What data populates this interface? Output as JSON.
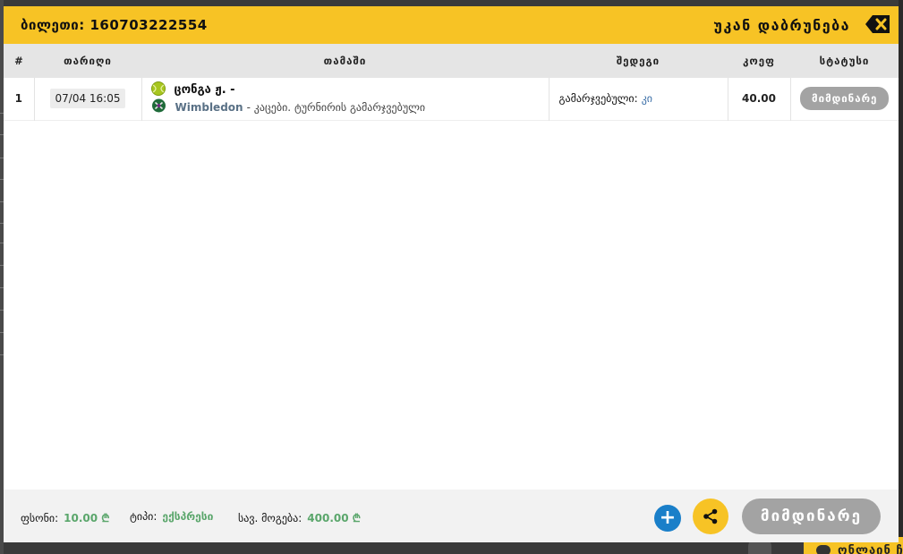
{
  "modal": {
    "ticket_label": "ბილეთი:",
    "ticket_number": "160703222554",
    "back_label": "უკან დაბრუნება"
  },
  "table": {
    "headers": [
      "#",
      "თარიღი",
      "თამაში",
      "შედეგი",
      "კოეფ",
      "სტატუსი"
    ],
    "rows": [
      {
        "num": "1",
        "date": "07/04 16:05",
        "player": "ცონგა ჟ. -",
        "tournament": "Wimbledon",
        "tournament_desc": "- კაცები. ტურნირის გამარჯვებული",
        "result_label": "გამარჯვებული:",
        "result_value": "კი",
        "odds": "40.00",
        "status": "მიმდინარე"
      }
    ]
  },
  "footer": {
    "stake_label": "ფსონი:",
    "stake_value": "10.00 ₾",
    "type_label": "ტიპი:",
    "type_value": "ექსპრესი",
    "win_label": "სავ. მოგება:",
    "win_value": "400.00 ₾",
    "status_button": "მიმდინარე"
  },
  "background": {
    "chat_label": "ონლაინ ჩ"
  },
  "icons": {
    "close": "backspace-x-icon",
    "sport": "tennis-ball-icon",
    "tournament": "wimbledon-logo-icon",
    "add": "plus-icon",
    "share": "share-icon",
    "chat": "chat-bubble-icon"
  },
  "colors": {
    "accent": "#f7c325",
    "status_grey": "#a3a3a3",
    "money_green": "#5aa66b",
    "link_blue": "#3c6fa8",
    "plus_blue": "#1a7fc9"
  }
}
